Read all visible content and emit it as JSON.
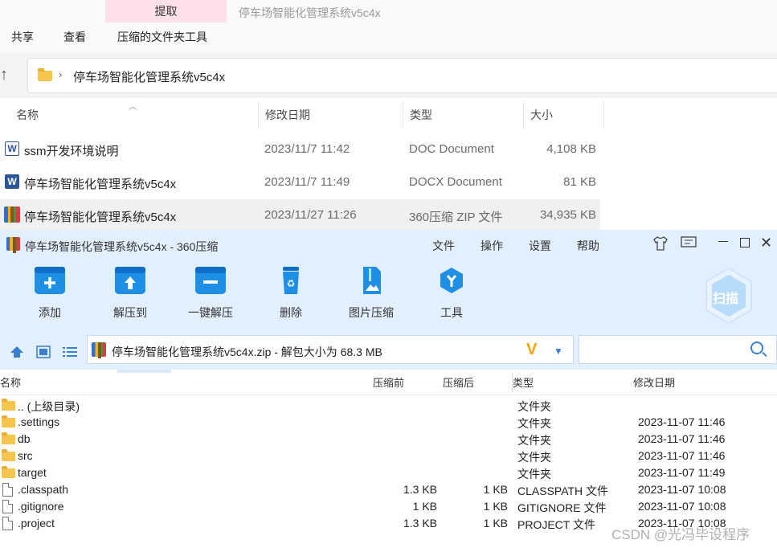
{
  "explorer": {
    "extract_tab": "提取",
    "window_title": "停车场智能化管理系统v5c4x",
    "menu": [
      "共享",
      "查看",
      "压缩的文件夹工具"
    ],
    "breadcrumb": "停车场智能化管理系统v5c4x",
    "columns": [
      "名称",
      "修改日期",
      "类型",
      "大小"
    ],
    "files": [
      {
        "name": "ssm开发环境说明",
        "date": "2023/11/7 11:42",
        "type": "DOC Document",
        "size": "4,108 KB",
        "icon": "word-doc-icon"
      },
      {
        "name": "停车场智能化管理系统v5c4x",
        "date": "2023/11/7 11:49",
        "type": "DOCX Document",
        "size": "81 KB",
        "icon": "word-docx-icon"
      },
      {
        "name": "停车场智能化管理系统v5c4x",
        "date": "2023/11/27 11:26",
        "type": "360压缩 ZIP 文件",
        "size": "34,935 KB",
        "icon": "zip-archive-icon",
        "selected": true
      }
    ]
  },
  "zip": {
    "title": "停车场智能化管理系统v5c4x - 360压缩",
    "menu": [
      "文件",
      "操作",
      "设置",
      "帮助"
    ],
    "toolbar": [
      "添加",
      "解压到",
      "一键解压",
      "删除",
      "图片压缩",
      "工具"
    ],
    "scan_label": "扫描",
    "path": "停车场智能化管理系统v5c4x.zip - 解包大小为 68.3 MB",
    "columns": [
      "名称",
      "压缩前",
      "压缩后",
      "类型",
      "修改日期"
    ],
    "rows": [
      {
        "name": ".. (上级目录)",
        "before": "",
        "after": "",
        "type": "文件夹",
        "date": "",
        "kind": "folder"
      },
      {
        "name": ".settings",
        "before": "",
        "after": "",
        "type": "文件夹",
        "date": "2023-11-07 11:46",
        "kind": "folder"
      },
      {
        "name": "db",
        "before": "",
        "after": "",
        "type": "文件夹",
        "date": "2023-11-07 11:46",
        "kind": "folder"
      },
      {
        "name": "src",
        "before": "",
        "after": "",
        "type": "文件夹",
        "date": "2023-11-07 11:46",
        "kind": "folder"
      },
      {
        "name": "target",
        "before": "",
        "after": "",
        "type": "文件夹",
        "date": "2023-11-07 11:49",
        "kind": "folder"
      },
      {
        "name": ".classpath",
        "before": "1.3 KB",
        "after": "1 KB",
        "type": "CLASSPATH 文件",
        "date": "2023-11-07 10:08",
        "kind": "file"
      },
      {
        "name": ".gitignore",
        "before": "1 KB",
        "after": "1 KB",
        "type": "GITIGNORE 文件",
        "date": "2023-11-07 10:08",
        "kind": "file"
      },
      {
        "name": ".project",
        "before": "1.3 KB",
        "after": "1 KB",
        "type": "PROJECT 文件",
        "date": "2023-11-07 10:08",
        "kind": "file"
      }
    ]
  },
  "watermark": "CSDN @光冯毕设程序"
}
